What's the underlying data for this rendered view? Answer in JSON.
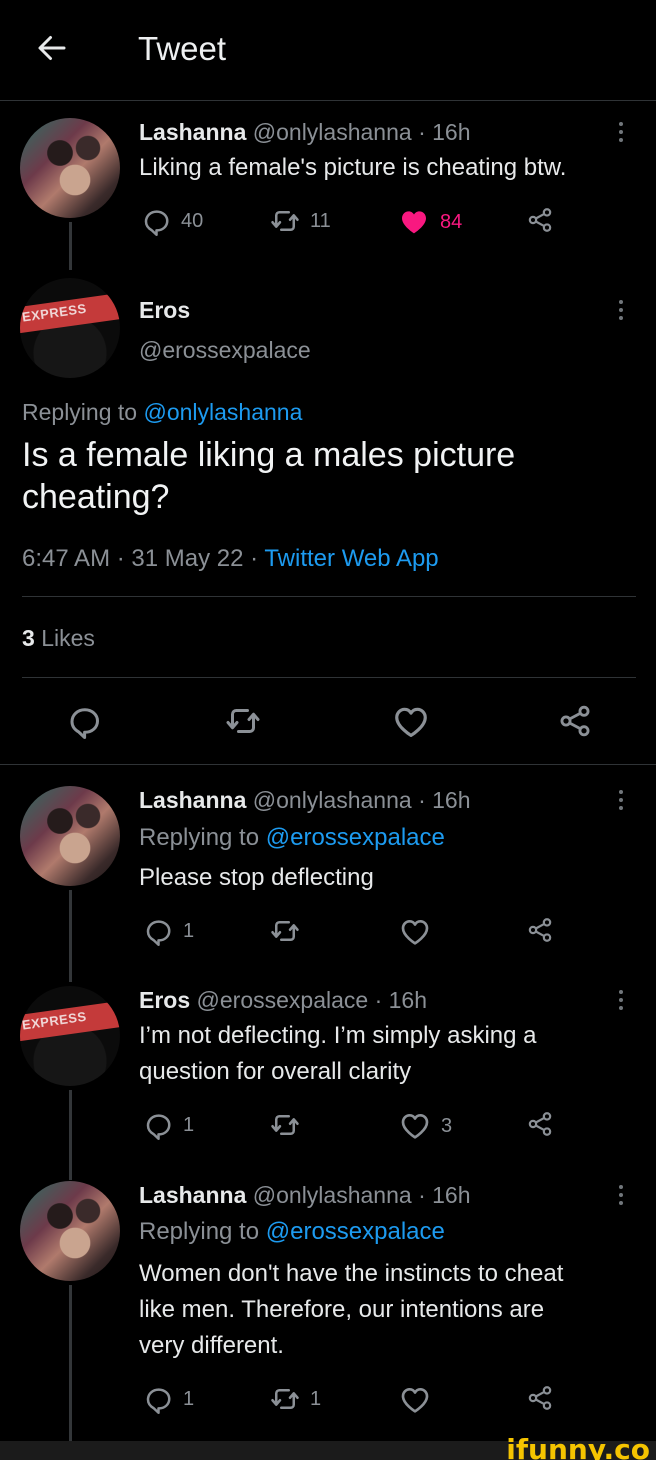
{
  "header": {
    "title": "Tweet"
  },
  "original_tweet": {
    "name": "Lashanna",
    "handle": "@onlylashanna",
    "time": "· 16h",
    "text": "Liking a female's picture is cheating btw.",
    "replies": "40",
    "retweets": "11",
    "likes": "84",
    "liked_color": "#f91880"
  },
  "main_tweet": {
    "name": "Eros",
    "handle": "@erossexpalace",
    "replying_prefix": "Replying to",
    "replying_to": "@onlylashanna",
    "text_line1": "Is a female liking a males picture",
    "text_line2": "cheating?",
    "timestamp": "6:47 AM · 31 May 22 ·",
    "source": "Twitter Web App",
    "likes_count": "3",
    "likes_label": "Likes"
  },
  "replies": [
    {
      "name": "Lashanna",
      "handle": "@onlylashanna",
      "time": "· 16h",
      "replying_prefix": "Replying to",
      "replying_to": "@erossexpalace",
      "text_lines": [
        "Please stop deflecting"
      ],
      "replies": "1",
      "retweets": "",
      "likes": ""
    },
    {
      "name": "Eros",
      "handle": "@erossexpalace",
      "time": "· 16h",
      "text_lines": [
        "I’m not deflecting. I’m simply asking a",
        "question for overall clarity"
      ],
      "replies": "1",
      "retweets": "",
      "likes": "3"
    },
    {
      "name": "Lashanna",
      "handle": "@onlylashanna",
      "time": "· 16h",
      "replying_prefix": "Replying to",
      "replying_to": "@erossexpalace",
      "text_lines": [
        "Women don't have the instincts to cheat",
        "like men. Therefore, our intentions are",
        "very different."
      ],
      "replies": "1",
      "retweets": "1",
      "likes": ""
    }
  ],
  "avatar_badge": "EXPRESS",
  "watermark": "ifunny.co",
  "colors": {
    "accent": "#1d9bf0",
    "background": "#000000",
    "like": "#f91880",
    "watermark": "#f5c400"
  },
  "icons": [
    "back-arrow-icon",
    "more-icon",
    "reply-icon",
    "retweet-icon",
    "like-icon",
    "share-icon"
  ]
}
